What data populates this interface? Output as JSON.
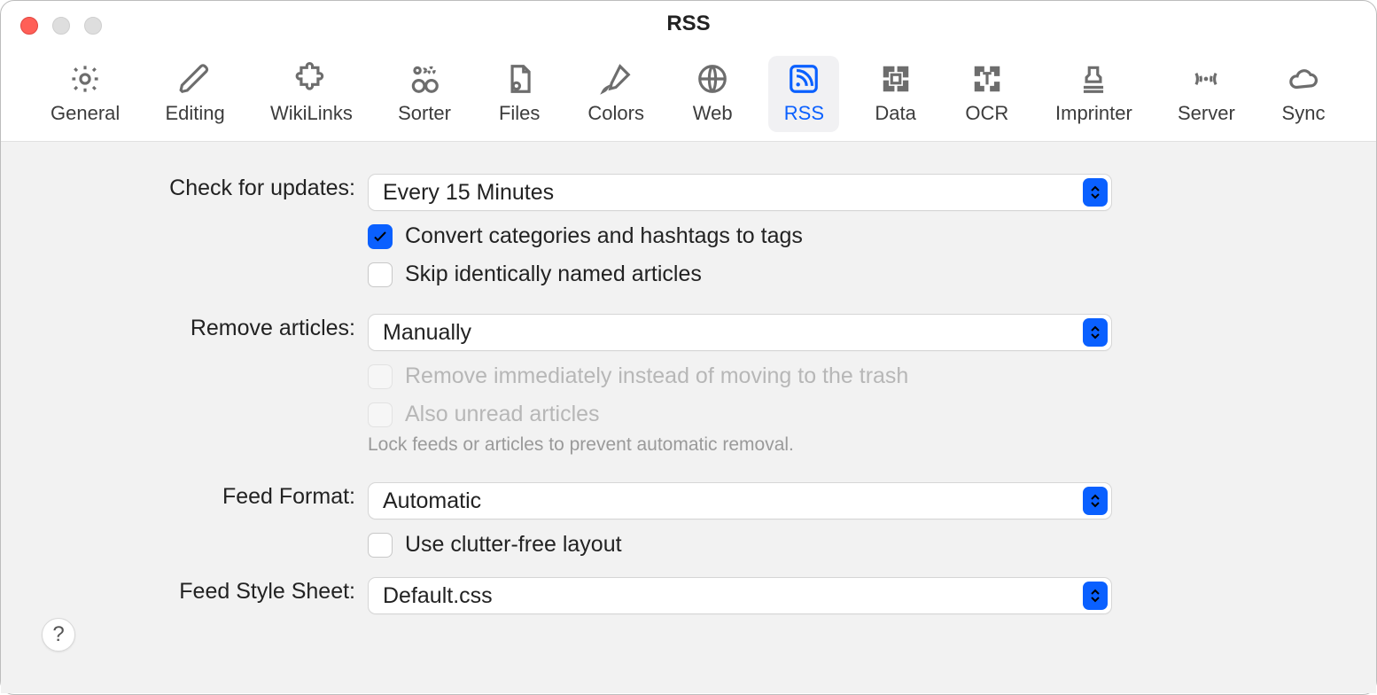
{
  "window": {
    "title": "RSS"
  },
  "toolbar": {
    "items": [
      {
        "label": "General"
      },
      {
        "label": "Editing"
      },
      {
        "label": "WikiLinks"
      },
      {
        "label": "Sorter"
      },
      {
        "label": "Files"
      },
      {
        "label": "Colors"
      },
      {
        "label": "Web"
      },
      {
        "label": "RSS"
      },
      {
        "label": "Data"
      },
      {
        "label": "OCR"
      },
      {
        "label": "Imprinter"
      },
      {
        "label": "Server"
      },
      {
        "label": "Sync"
      }
    ]
  },
  "form": {
    "check_updates": {
      "label": "Check for updates:",
      "value": "Every 15 Minutes"
    },
    "convert_tags": {
      "label": "Convert categories and hashtags to tags",
      "checked": true
    },
    "skip_dupes": {
      "label": "Skip identically named articles",
      "checked": false
    },
    "remove_articles": {
      "label": "Remove articles:",
      "value": "Manually"
    },
    "remove_now": {
      "label": "Remove immediately instead of moving to the trash",
      "checked": false,
      "disabled": true
    },
    "also_unread": {
      "label": "Also unread articles",
      "checked": false,
      "disabled": true
    },
    "lock_hint": "Lock feeds or articles to prevent automatic removal.",
    "feed_format": {
      "label": "Feed Format:",
      "value": "Automatic"
    },
    "clutter_free": {
      "label": "Use clutter-free layout",
      "checked": false
    },
    "feed_style": {
      "label": "Feed Style Sheet:",
      "value": "Default.css"
    }
  },
  "help": "?"
}
